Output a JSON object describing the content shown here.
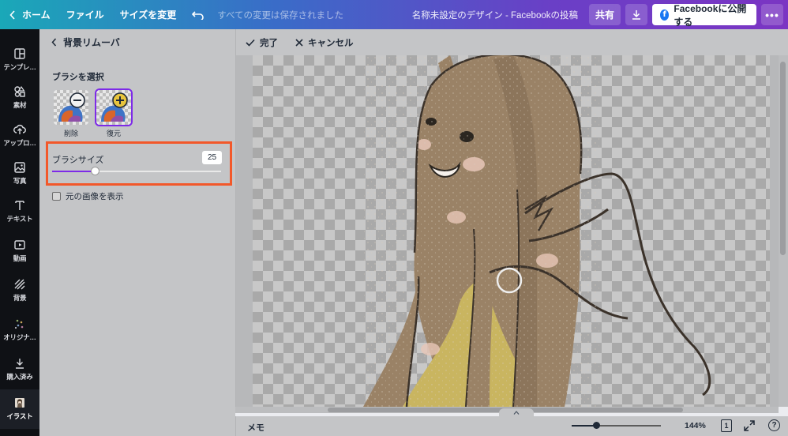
{
  "topbar": {
    "home_label": "ホーム",
    "file_label": "ファイル",
    "resize_label": "サイズを変更",
    "save_status": "すべての変更は保存されました",
    "doc_title": "名称未設定のデザイン - Facebookの投稿",
    "share_label": "共有",
    "publish_label": "Facebookに公開する"
  },
  "rail": {
    "items": [
      {
        "label": "テンプレ…",
        "icon": "template-icon"
      },
      {
        "label": "素材",
        "icon": "elements-icon"
      },
      {
        "label": "アップロ…",
        "icon": "upload-icon"
      },
      {
        "label": "写真",
        "icon": "photo-icon"
      },
      {
        "label": "テキスト",
        "icon": "text-icon"
      },
      {
        "label": "動画",
        "icon": "video-icon"
      },
      {
        "label": "背景",
        "icon": "background-icon"
      },
      {
        "label": "オリジナ…",
        "icon": "original-icon"
      },
      {
        "label": "購入済み",
        "icon": "download-icon"
      },
      {
        "label": "イラスト",
        "icon": "illustration-icon"
      }
    ]
  },
  "panel": {
    "title": "背景リムーバ",
    "brush_select_title": "ブラシを選択",
    "brush_erase_label": "削除",
    "brush_restore_label": "復元",
    "brush_size_label": "ブラシサイズ",
    "brush_size_value": "25",
    "brush_size_fraction": 0.25,
    "show_original_label": "元の画像を表示"
  },
  "actionbar": {
    "done_label": "完了",
    "cancel_label": "キャンセル"
  },
  "bottombar": {
    "memo_label": "メモ",
    "zoom_label": "144%",
    "zoom_fraction": 0.27,
    "page_number": "1",
    "help_label": "?"
  },
  "colors": {
    "accent": "#7d2ae8",
    "highlight_border": "#f2582a",
    "hair": "#9a8266",
    "shirt": "#c9b560",
    "skin": "#e8c7b8"
  }
}
